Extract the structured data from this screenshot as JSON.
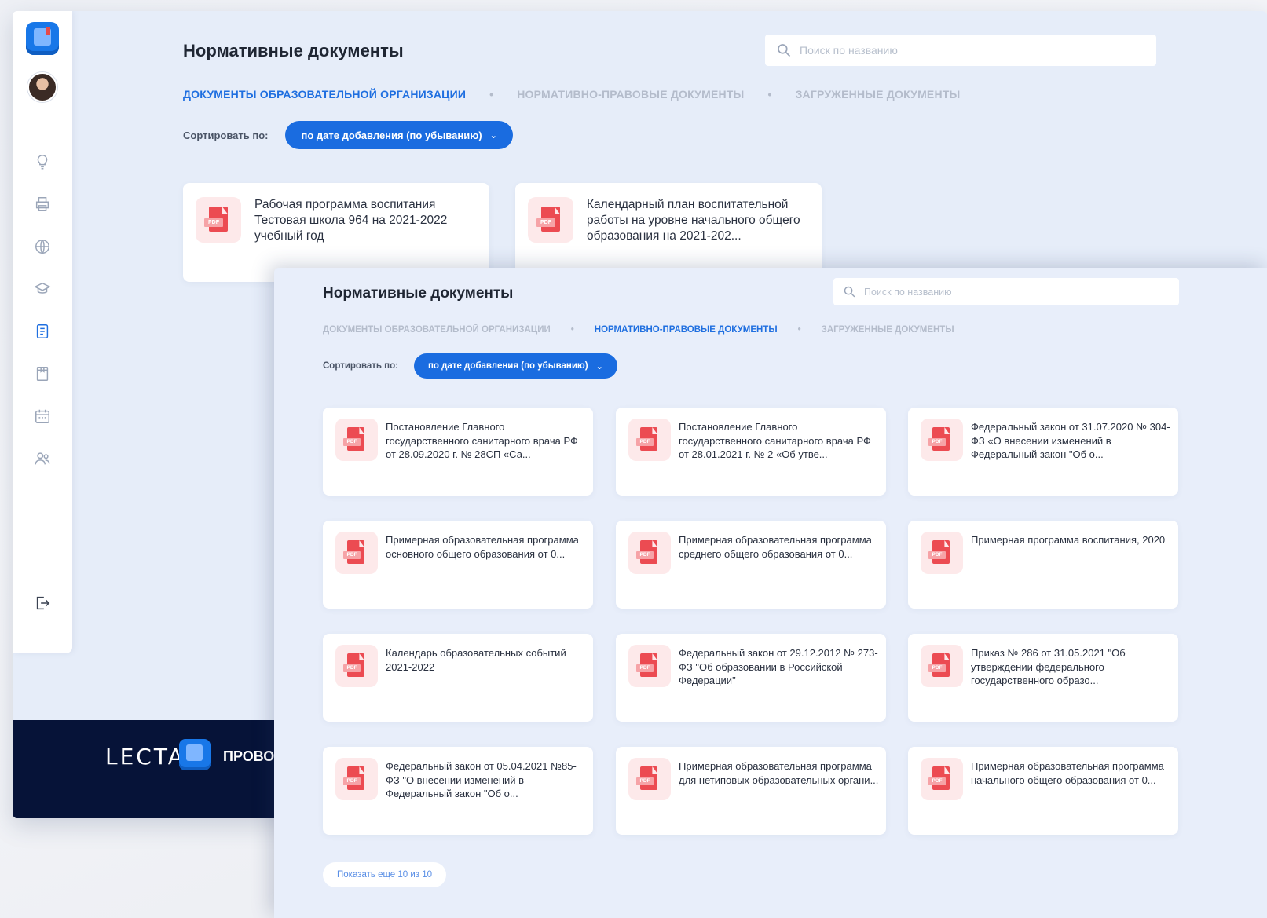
{
  "back": {
    "title": "Нормативные документы",
    "search_placeholder": "Поиск по названию",
    "tabs": [
      {
        "label": "ДОКУМЕНТЫ ОБРАЗОВАТЕЛЬНОЙ ОРГАНИЗАЦИИ",
        "active": true
      },
      {
        "label": "НОРМАТИВНО-ПРАВОВЫЕ ДОКУМЕНТЫ",
        "active": false
      },
      {
        "label": "ЗАГРУЖЕННЫЕ ДОКУМЕНТЫ",
        "active": false
      }
    ],
    "separator": "•",
    "sort_label": "Сортировать по:",
    "sort_value": "по дате добавления (по убыванию)",
    "documents": [
      {
        "text": "Рабочая программа воспитания Тестовая школа 964 на 2021-2022 учебный год"
      },
      {
        "text": "Календарный план воспитательной работы на уровне начального общего образования на 2021-202..."
      }
    ],
    "footer": {
      "brand": "LECTA",
      "product": "ПРОВО"
    }
  },
  "sidebar_icons": [
    "lightbulb-icon",
    "printer-icon",
    "globe-icon",
    "graduation-cap-icon",
    "document-icon",
    "book-icon",
    "calendar-icon",
    "users-icon"
  ],
  "logout_icon": "logout-icon",
  "pdf_tag": "PDF",
  "front": {
    "title": "Нормативные документы",
    "search_placeholder": "Поиск по названию",
    "tabs": [
      {
        "label": "ДОКУМЕНТЫ ОБРАЗОВАТЕЛЬНОЙ ОРГАНИЗАЦИИ",
        "active": false
      },
      {
        "label": "НОРМАТИВНО-ПРАВОВЫЕ ДОКУМЕНТЫ",
        "active": true
      },
      {
        "label": "ЗАГРУЖЕННЫЕ ДОКУМЕНТЫ",
        "active": false
      }
    ],
    "separator": "•",
    "sort_label": "Сортировать по:",
    "sort_value": "по дате добавления (по убыванию)",
    "documents": [
      {
        "text": "Постановление Главного государственного санитарного врача РФ от 28.09.2020 г. № 28СП «Са..."
      },
      {
        "text": "Постановление Главного государственного санитарного врача РФ от 28.01.2021 г. № 2 «Об утве..."
      },
      {
        "text": "Федеральный закон от 31.07.2020 № 304-ФЗ «О внесении изменений в Федеральный закон \"Об о..."
      },
      {
        "text": "Примерная образовательная программа основного общего образования от 0..."
      },
      {
        "text": "Примерная образовательная программа среднего общего образования от 0..."
      },
      {
        "text": "Примерная программа воспитания, 2020"
      },
      {
        "text": "Календарь образовательных событий 2021-2022"
      },
      {
        "text": "Федеральный закон от 29.12.2012 № 273-ФЗ \"Об образовании в Российской Федерации\""
      },
      {
        "text": "Приказ № 286 от 31.05.2021 \"Об утверждении федерального государственного образо..."
      },
      {
        "text": "Федеральный закон от 05.04.2021 №85-ФЗ \"О внесении изменений в Федеральный закон \"Об о..."
      },
      {
        "text": "Примерная образовательная программа для нетиповых образовательных органи..."
      },
      {
        "text": "Примерная образовательная программа начального общего образования от 0..."
      }
    ],
    "show_more": "Показать еще 10 из 10"
  },
  "colors": {
    "accent": "#1a6ce0",
    "pdf_red": "#ec4b52",
    "footer_bg": "#061338",
    "page_bg": "#e6edf9"
  }
}
